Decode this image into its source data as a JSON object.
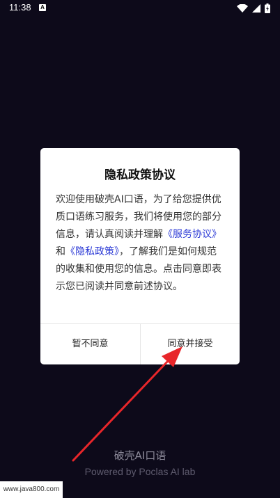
{
  "status_bar": {
    "time": "11:38",
    "notification_badge": "A",
    "icons": [
      "wifi-icon",
      "signal-icon",
      "battery-icon"
    ]
  },
  "dialog": {
    "title": "隐私政策协议",
    "body": {
      "part1": "欢迎使用破壳AI口语，为了给您提供优质口语练习服务，我们将使用您的部分信息，请认真阅读并理解",
      "link_service": "《服务协议》",
      "and": "和",
      "link_privacy": "《隐私政策》",
      "part2": "，了解我们是如何规范的收集和使用您的信息。点击同意即表示您已阅读并同意前述协议。"
    },
    "buttons": {
      "disagree": "暂不同意",
      "agree": "同意并接受"
    }
  },
  "footer": {
    "app_name": "破壳AI口语",
    "powered_by": "Powered by Poclas AI lab"
  },
  "watermark": "www.java800.com",
  "colors": {
    "background": "#0d0a1a",
    "link": "#2d3bd6",
    "arrow": "#e8262a"
  }
}
